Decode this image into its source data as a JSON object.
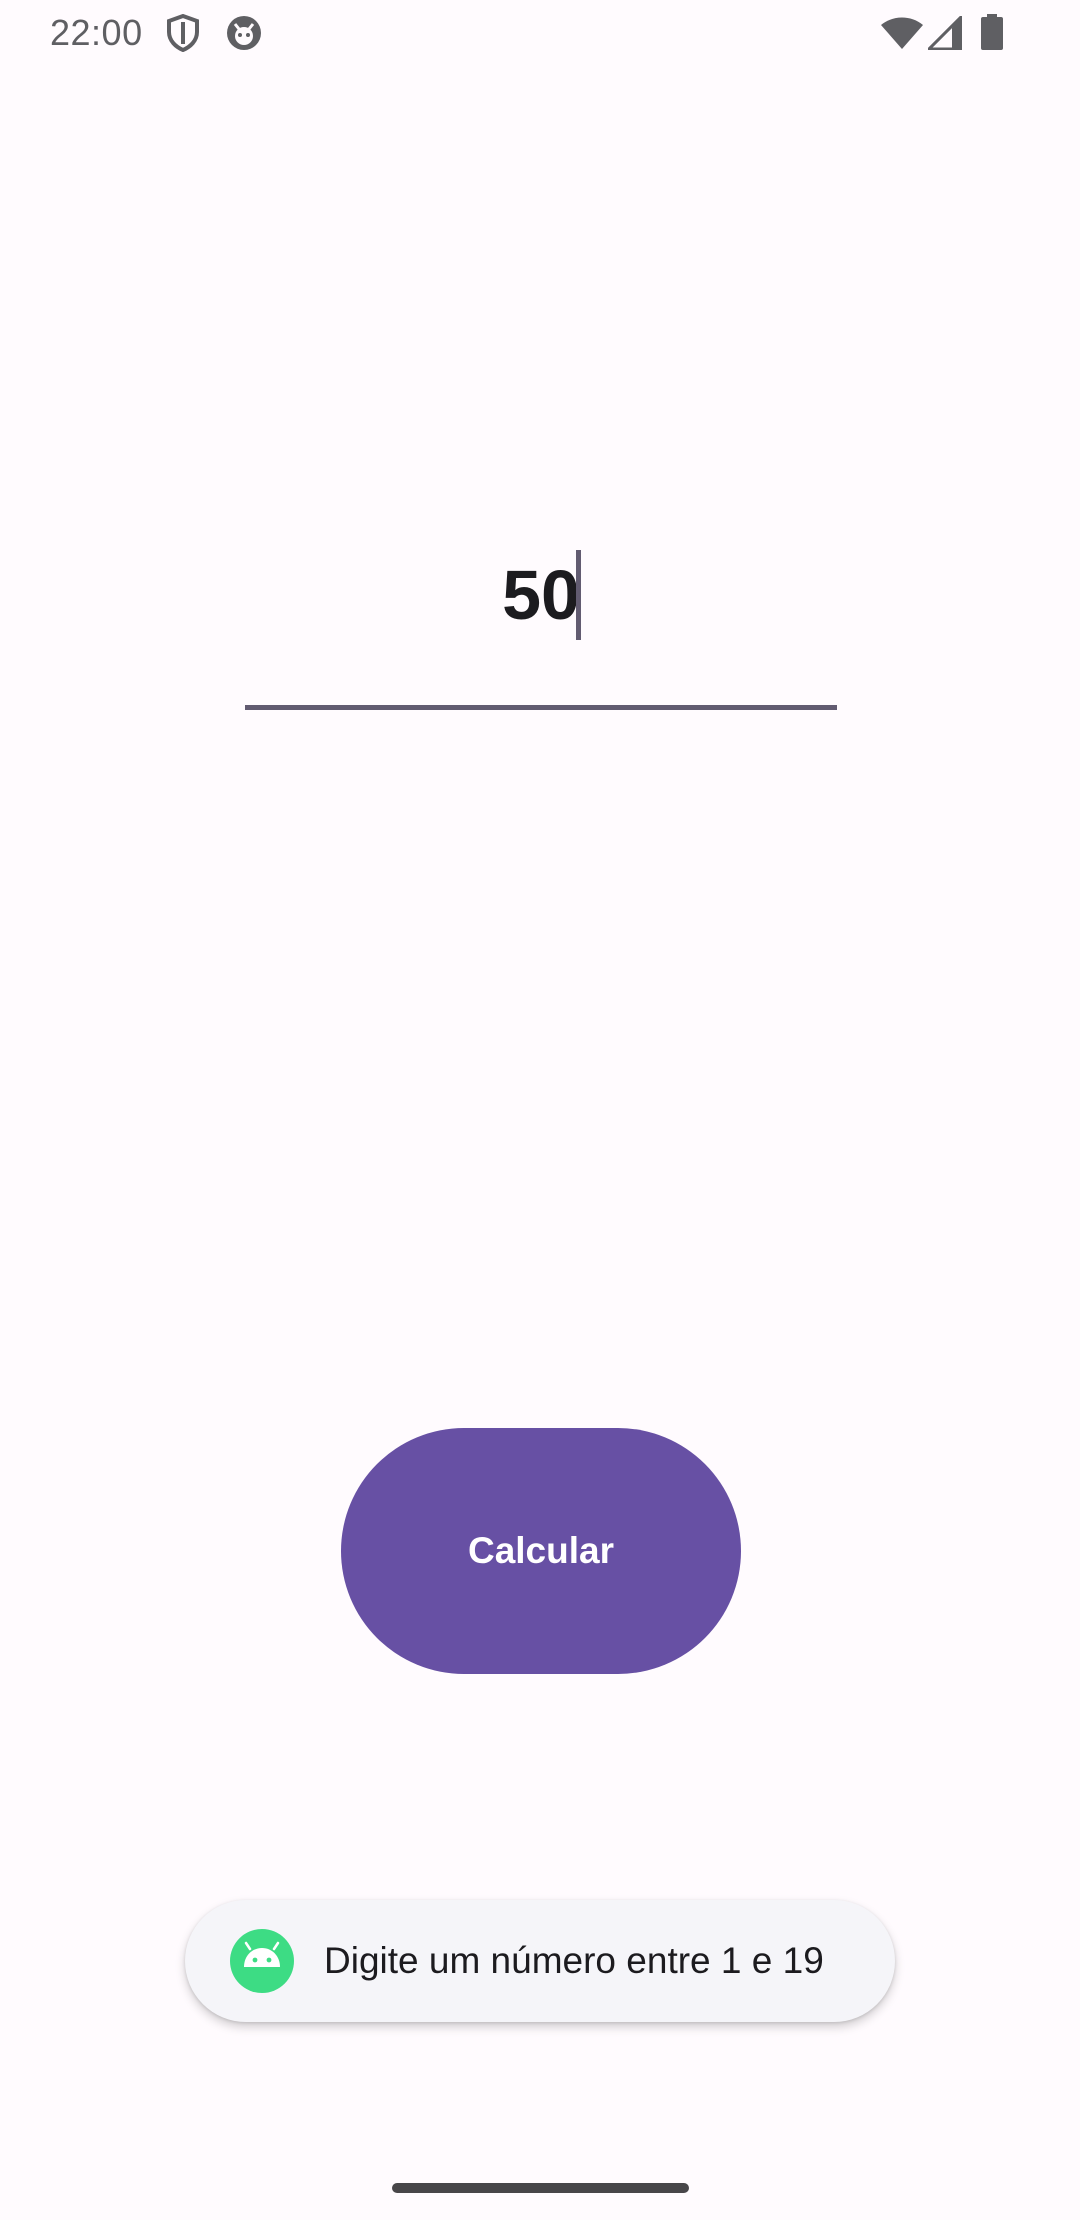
{
  "status_bar": {
    "time": "22:00",
    "left_icons": [
      "shield-icon",
      "app-notification-icon"
    ],
    "right_icons": [
      "wifi-icon",
      "cell-signal-icon",
      "battery-icon"
    ]
  },
  "input": {
    "value": "50"
  },
  "button": {
    "label": "Calcular"
  },
  "toast": {
    "icon": "android-icon",
    "message": "Digite um número entre 1 e 19"
  },
  "colors": {
    "background": "#fffbfe",
    "primary": "#6750a4",
    "underline": "#625b71",
    "toast_background": "#f5f5f9",
    "android_green": "#3ddc84"
  }
}
